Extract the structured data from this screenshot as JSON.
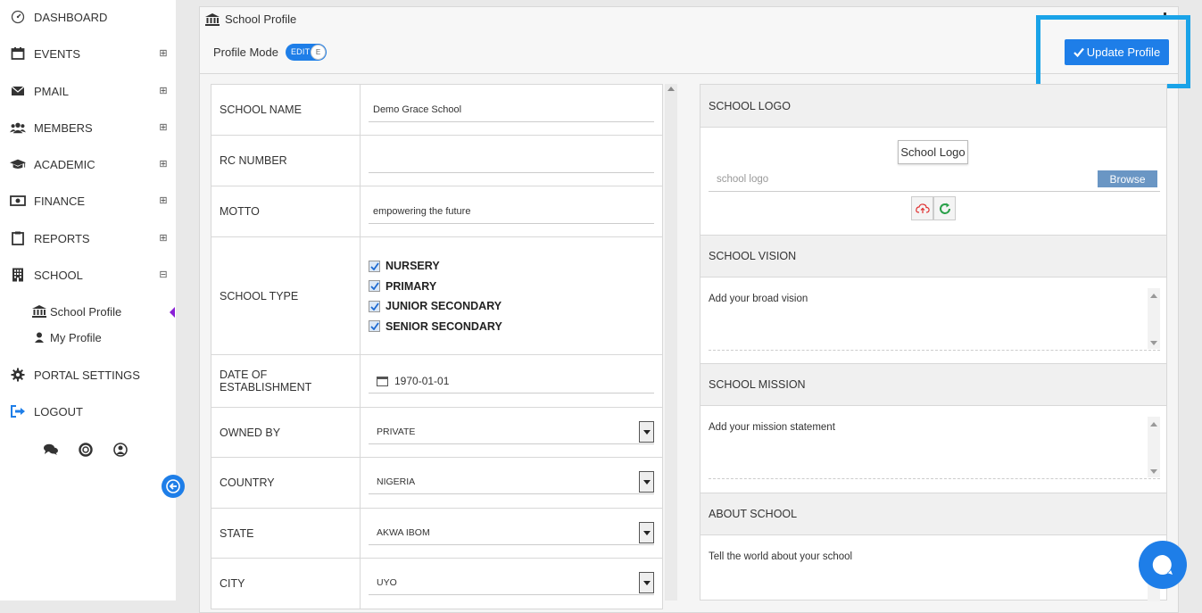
{
  "sidebar": {
    "items": [
      {
        "label": "DASHBOARD",
        "icon": "dashboard-icon",
        "toggle": ""
      },
      {
        "label": "EVENTS",
        "icon": "calendar-icon",
        "toggle": "⊞"
      },
      {
        "label": "PMAIL",
        "icon": "envelope-icon",
        "toggle": "⊞"
      },
      {
        "label": "MEMBERS",
        "icon": "users-icon",
        "toggle": "⊞"
      },
      {
        "label": "ACADEMIC",
        "icon": "graduation-cap-icon",
        "toggle": "⊞"
      },
      {
        "label": "FINANCE",
        "icon": "money-icon",
        "toggle": "⊞"
      },
      {
        "label": "REPORTS",
        "icon": "clipboard-icon",
        "toggle": "⊞"
      },
      {
        "label": "SCHOOL",
        "icon": "building-icon",
        "toggle": "⊟"
      },
      {
        "label": "PORTAL SETTINGS",
        "icon": "gear-icon",
        "toggle": ""
      },
      {
        "label": "LOGOUT",
        "icon": "logout-icon",
        "toggle": ""
      }
    ],
    "sub_items": [
      {
        "label": "School Profile",
        "icon": "institution-icon"
      },
      {
        "label": "My Profile",
        "icon": "user-icon"
      }
    ]
  },
  "panel": {
    "title": "School Profile",
    "profile_mode_label": "Profile Mode",
    "toggle_text": "EDIT",
    "toggle_knob": "E",
    "update_button": "Update Profile"
  },
  "form": {
    "school_name": {
      "label": "SCHOOL NAME",
      "value": "Demo Grace School"
    },
    "rc_number": {
      "label": "RC NUMBER",
      "value": ""
    },
    "motto": {
      "label": "MOTTO",
      "value": "empowering the future"
    },
    "school_type": {
      "label": "SCHOOL TYPE",
      "options": [
        "NURSERY",
        "PRIMARY",
        "JUNIOR SECONDARY",
        "SENIOR SECONDARY"
      ]
    },
    "date_established": {
      "label": "DATE OF ESTABLISHMENT",
      "value": "1970-01-01"
    },
    "owned_by": {
      "label": "OWNED BY",
      "value": "PRIVATE"
    },
    "country": {
      "label": "COUNTRY",
      "value": "NIGERIA"
    },
    "state": {
      "label": "STATE",
      "value": "AKWA IBOM"
    },
    "city": {
      "label": "CITY",
      "value": "UYO"
    }
  },
  "right": {
    "logo": {
      "heading": "SCHOOL LOGO",
      "button": "School Logo",
      "placeholder": "school logo",
      "browse": "Browse"
    },
    "vision": {
      "heading": "SCHOOL VISION",
      "placeholder": "Add your broad vision"
    },
    "mission": {
      "heading": "SCHOOL MISSION",
      "placeholder": "Add your mission statement"
    },
    "about": {
      "heading": "ABOUT SCHOOL",
      "placeholder": "Tell the world about your school"
    }
  },
  "colors": {
    "accent": "#1e7ee8",
    "highlight": "#1aa3e8",
    "active_pointer": "#8a1fd6"
  }
}
